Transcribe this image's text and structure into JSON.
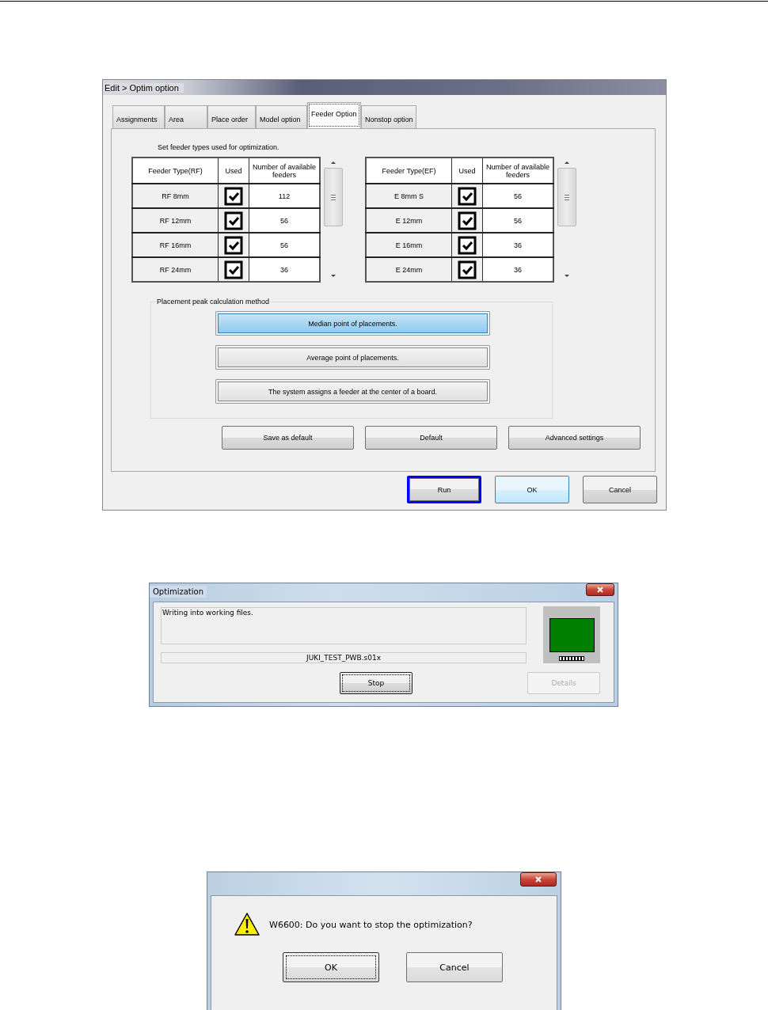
{
  "optim_dialog": {
    "title": "Edit > Optim option",
    "tabs": [
      {
        "label": "Assignments",
        "selected": false
      },
      {
        "label": "Area",
        "selected": false
      },
      {
        "label": "Place order",
        "selected": false
      },
      {
        "label": "Model option",
        "selected": false
      },
      {
        "label": "Feeder Option",
        "selected": true
      },
      {
        "label": "Nonstop option",
        "selected": false
      }
    ],
    "instruction": "Set feeder types used for optimization.",
    "tables": [
      {
        "columns": [
          "Feeder Type(RF)",
          "Used",
          "Number of available feeders"
        ],
        "rows": [
          {
            "type": "RF 8mm",
            "used": true,
            "count": "112"
          },
          {
            "type": "RF 12mm",
            "used": true,
            "count": "56"
          },
          {
            "type": "RF 16mm",
            "used": true,
            "count": "56"
          },
          {
            "type": "RF 24mm",
            "used": true,
            "count": "36"
          }
        ]
      },
      {
        "columns": [
          "Feeder Type(EF)",
          "Used",
          "Number of available feeders"
        ],
        "rows": [
          {
            "type": "E 8mm S",
            "used": true,
            "count": "56"
          },
          {
            "type": "E 12mm",
            "used": true,
            "count": "56"
          },
          {
            "type": "E 16mm",
            "used": true,
            "count": "36"
          },
          {
            "type": "E 24mm",
            "used": true,
            "count": "36"
          }
        ]
      }
    ],
    "peak_method": {
      "legend": "Placement peak calculation method",
      "options": [
        {
          "label": "Median point of placements.",
          "selected": true
        },
        {
          "label": "Average point of placements.",
          "selected": false
        },
        {
          "label": "The system assigns a feeder at the center of a board.",
          "selected": false
        }
      ]
    },
    "setting_buttons": [
      "Save as default",
      "Default",
      "Advanced settings"
    ],
    "footer_buttons": [
      {
        "label": "Run",
        "highlighted": true,
        "default": false
      },
      {
        "label": "OK",
        "highlighted": false,
        "default": true
      },
      {
        "label": "Cancel",
        "highlighted": false,
        "default": false
      }
    ]
  },
  "progress_dialog": {
    "title": "Optimization",
    "message": "Writing into working files.",
    "file": "JUKI_TEST_PWB.s01x",
    "buttons": [
      {
        "label": "Stop",
        "disabled": false,
        "focused": true
      },
      {
        "label": "Details",
        "disabled": true,
        "focused": false
      }
    ]
  },
  "confirm_dialog": {
    "message": "W6600: Do you want to stop the optimization?",
    "buttons": [
      {
        "label": "OK",
        "focused": true
      },
      {
        "label": "Cancel",
        "focused": false
      }
    ]
  }
}
